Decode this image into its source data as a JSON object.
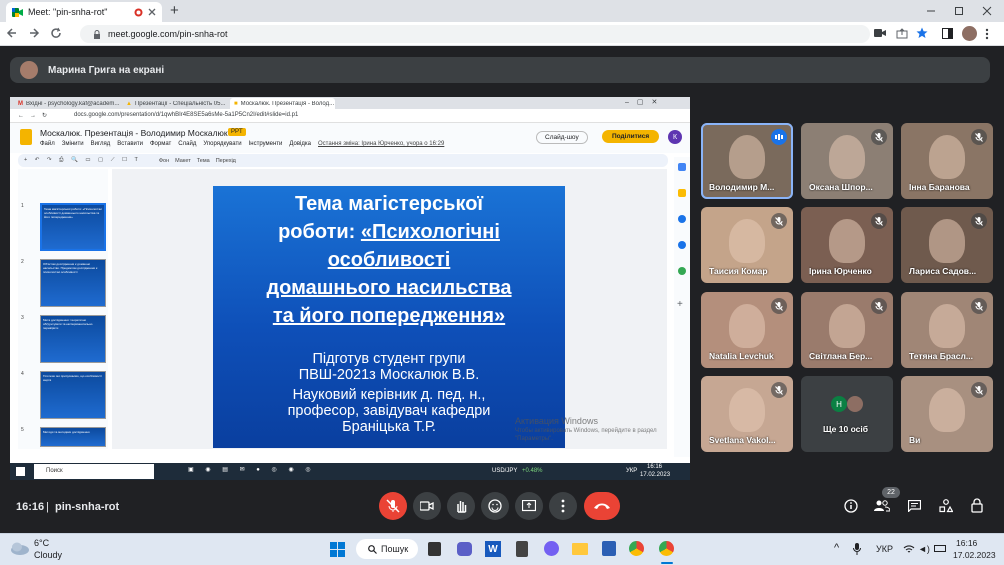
{
  "browser": {
    "tab_title": "Meet: \"pin-snha-rot\"",
    "new_tab": "+",
    "url": "meet.google.com/pin-snha-rot",
    "window_controls": [
      "minimize",
      "restore",
      "close"
    ]
  },
  "meet": {
    "presenter_banner": "Марина Грига на екрані",
    "clock": "16:16",
    "meeting_code": "pin-snha-rot",
    "participants_count": "22",
    "participants": [
      {
        "name": "Володимир М...",
        "speaking": true
      },
      {
        "name": "Оксана Шпор...",
        "muted": true
      },
      {
        "name": "Інна Баранова",
        "muted": true
      },
      {
        "name": "Таисия Комар",
        "muted": true
      },
      {
        "name": "Ірина Юрченко",
        "muted": true
      },
      {
        "name": "Лариса Садов...",
        "muted": true
      },
      {
        "name": "Natalia Levchuk",
        "muted": true
      },
      {
        "name": "Світлана Бер...",
        "muted": true
      },
      {
        "name": "Тетяна Брасл...",
        "muted": true
      },
      {
        "name": "Svetlana Vakol...",
        "muted": true
      },
      {
        "name": "Ще 10 осіб",
        "initial": "H"
      },
      {
        "name": "Ви",
        "muted": true
      }
    ]
  },
  "shared": {
    "tabs": [
      "Вхідні - psychology.kaf@academ...",
      "Презентації - Спеціальність 05...",
      "Москалюк. Презентація - Волод..."
    ],
    "url": "docs.google.com/presentation/d/1qwhBIr4E8SE5a6sMe-5a1P5Cn2I/edit#slide=id.p1",
    "doc_title": "Москалюк. Презентація - Володимир Москалюк",
    "doc_badge": "PPT",
    "menu": [
      "Файл",
      "Змінити",
      "Вигляд",
      "Вставити",
      "Формат",
      "Слайд",
      "Упорядкувати",
      "Інструменти",
      "Довідка"
    ],
    "last_edit": "Остання зміна: Ірина Юрченко, учора о 16:29",
    "slideshow_label": "Слайд-шоу",
    "share_label": "Поділитися",
    "user_initial": "К",
    "toolbar": [
      "Фон",
      "Макет",
      "Тема",
      "Перехід"
    ],
    "thumb_numbers": [
      "1",
      "2",
      "3",
      "4",
      "5"
    ],
    "thumbs": [
      "Тема магістерської роботи: «Психологічні особливості домашнього насильства та його попередження»",
      "Об'єктом дослідження є домашнє насильство. Предметом дослідження є психологічні особливості",
      "Мета дослідження: теоретично обґрунтувати та експериментально перевірити",
      "Гіпотеза: ми припускаємо, що особливості жертв",
      "Методи та методики дослідження"
    ],
    "slide": {
      "title_line1": "Тема магістерської",
      "title_line2_plain": "роботи: ",
      "title_line2_underlined": "«Психологічні",
      "title_line3": "особливості",
      "title_line4": "домашнього насильства",
      "title_line5": "та його попередження»",
      "body_line1": "Підготув студент групи",
      "body_line2": "ПВШ-2021з Москалюк В.В.",
      "body_line3": "Науковий керівник д. пед. н.,",
      "body_line4": "професор, завідувач кафедри",
      "body_line5": "Браніцька Т.Р."
    },
    "watermark_title": "Активация Windows",
    "watermark_sub": "Чтобы активировать Windows, перейдите в раздел \"Параметры\".",
    "win_search": "Поиск",
    "win_ticker": "USD/JPY",
    "win_ticker_change": "+0.48%",
    "win_lang": "УКР",
    "win_time": "16:16",
    "win_date": "17.02.2023"
  },
  "taskbar": {
    "weather_temp": "6°C",
    "weather_desc": "Cloudy",
    "search_label": "Пошук",
    "lang": "УКР",
    "time": "16:16",
    "date": "17.02.2023"
  },
  "colors": {
    "meet_bg": "#202124",
    "end_call": "#ea4335",
    "slide_blue": "#1565c0",
    "speaking": "#8ab4f8"
  }
}
